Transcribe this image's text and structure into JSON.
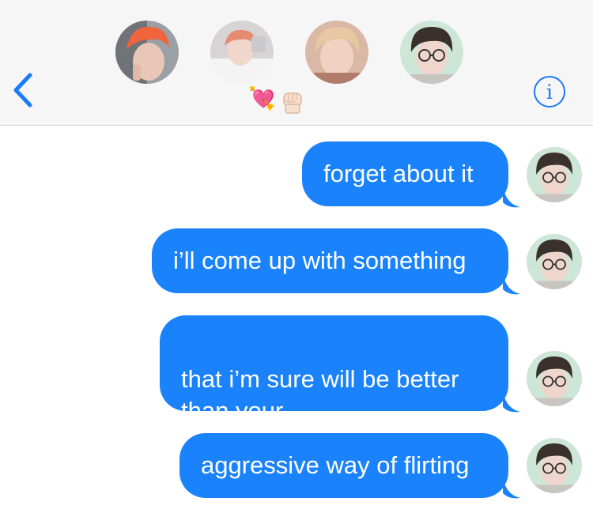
{
  "header": {
    "icons": {
      "back": "chevron-left-icon",
      "info": "info-icon"
    },
    "info_glyph": "i",
    "emoji_status": "💘",
    "colors": {
      "accent": "#1a7cf5",
      "bubble": "#1a82fb",
      "header_bg": "#f6f6f7"
    }
  },
  "messages": [
    {
      "text": "forget about it"
    },
    {
      "text": "i’ll come up with something"
    },
    {
      "text": "that i’m sure will be better\nthan your"
    },
    {
      "text": "aggressive way of flirting"
    }
  ]
}
